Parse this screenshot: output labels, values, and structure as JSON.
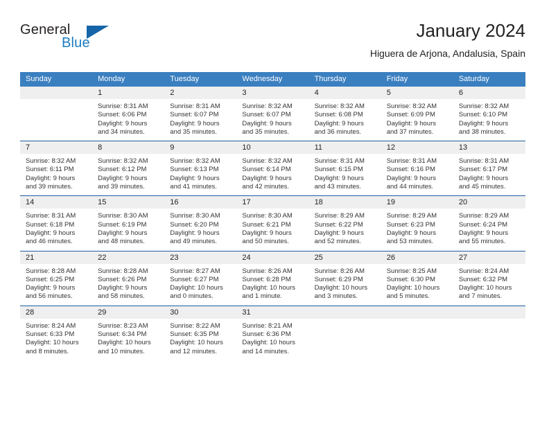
{
  "brand": {
    "name_part1": "General",
    "name_part2": "Blue",
    "triangle_color": "#1565a8",
    "blue_color": "#1a7cc2"
  },
  "header": {
    "title": "January 2024",
    "subtitle": "Higuera de Arjona, Andalusia, Spain",
    "header_bg": "#3a7fc0",
    "week_separator_color": "#1f5fa0",
    "daynum_band_color": "#efefef"
  },
  "calendar": {
    "day_names": [
      "Sunday",
      "Monday",
      "Tuesday",
      "Wednesday",
      "Thursday",
      "Friday",
      "Saturday"
    ],
    "weeks": [
      [
        {
          "day": "",
          "empty": true,
          "sunrise": "",
          "sunset": "",
          "daylight_line1": "",
          "daylight_line2": ""
        },
        {
          "day": "1",
          "empty": false,
          "sunrise": "Sunrise: 8:31 AM",
          "sunset": "Sunset: 6:06 PM",
          "daylight_line1": "Daylight: 9 hours",
          "daylight_line2": "and 34 minutes."
        },
        {
          "day": "2",
          "empty": false,
          "sunrise": "Sunrise: 8:31 AM",
          "sunset": "Sunset: 6:07 PM",
          "daylight_line1": "Daylight: 9 hours",
          "daylight_line2": "and 35 minutes."
        },
        {
          "day": "3",
          "empty": false,
          "sunrise": "Sunrise: 8:32 AM",
          "sunset": "Sunset: 6:07 PM",
          "daylight_line1": "Daylight: 9 hours",
          "daylight_line2": "and 35 minutes."
        },
        {
          "day": "4",
          "empty": false,
          "sunrise": "Sunrise: 8:32 AM",
          "sunset": "Sunset: 6:08 PM",
          "daylight_line1": "Daylight: 9 hours",
          "daylight_line2": "and 36 minutes."
        },
        {
          "day": "5",
          "empty": false,
          "sunrise": "Sunrise: 8:32 AM",
          "sunset": "Sunset: 6:09 PM",
          "daylight_line1": "Daylight: 9 hours",
          "daylight_line2": "and 37 minutes."
        },
        {
          "day": "6",
          "empty": false,
          "sunrise": "Sunrise: 8:32 AM",
          "sunset": "Sunset: 6:10 PM",
          "daylight_line1": "Daylight: 9 hours",
          "daylight_line2": "and 38 minutes."
        }
      ],
      [
        {
          "day": "7",
          "empty": false,
          "sunrise": "Sunrise: 8:32 AM",
          "sunset": "Sunset: 6:11 PM",
          "daylight_line1": "Daylight: 9 hours",
          "daylight_line2": "and 39 minutes."
        },
        {
          "day": "8",
          "empty": false,
          "sunrise": "Sunrise: 8:32 AM",
          "sunset": "Sunset: 6:12 PM",
          "daylight_line1": "Daylight: 9 hours",
          "daylight_line2": "and 39 minutes."
        },
        {
          "day": "9",
          "empty": false,
          "sunrise": "Sunrise: 8:32 AM",
          "sunset": "Sunset: 6:13 PM",
          "daylight_line1": "Daylight: 9 hours",
          "daylight_line2": "and 41 minutes."
        },
        {
          "day": "10",
          "empty": false,
          "sunrise": "Sunrise: 8:32 AM",
          "sunset": "Sunset: 6:14 PM",
          "daylight_line1": "Daylight: 9 hours",
          "daylight_line2": "and 42 minutes."
        },
        {
          "day": "11",
          "empty": false,
          "sunrise": "Sunrise: 8:31 AM",
          "sunset": "Sunset: 6:15 PM",
          "daylight_line1": "Daylight: 9 hours",
          "daylight_line2": "and 43 minutes."
        },
        {
          "day": "12",
          "empty": false,
          "sunrise": "Sunrise: 8:31 AM",
          "sunset": "Sunset: 6:16 PM",
          "daylight_line1": "Daylight: 9 hours",
          "daylight_line2": "and 44 minutes."
        },
        {
          "day": "13",
          "empty": false,
          "sunrise": "Sunrise: 8:31 AM",
          "sunset": "Sunset: 6:17 PM",
          "daylight_line1": "Daylight: 9 hours",
          "daylight_line2": "and 45 minutes."
        }
      ],
      [
        {
          "day": "14",
          "empty": false,
          "sunrise": "Sunrise: 8:31 AM",
          "sunset": "Sunset: 6:18 PM",
          "daylight_line1": "Daylight: 9 hours",
          "daylight_line2": "and 46 minutes."
        },
        {
          "day": "15",
          "empty": false,
          "sunrise": "Sunrise: 8:30 AM",
          "sunset": "Sunset: 6:19 PM",
          "daylight_line1": "Daylight: 9 hours",
          "daylight_line2": "and 48 minutes."
        },
        {
          "day": "16",
          "empty": false,
          "sunrise": "Sunrise: 8:30 AM",
          "sunset": "Sunset: 6:20 PM",
          "daylight_line1": "Daylight: 9 hours",
          "daylight_line2": "and 49 minutes."
        },
        {
          "day": "17",
          "empty": false,
          "sunrise": "Sunrise: 8:30 AM",
          "sunset": "Sunset: 6:21 PM",
          "daylight_line1": "Daylight: 9 hours",
          "daylight_line2": "and 50 minutes."
        },
        {
          "day": "18",
          "empty": false,
          "sunrise": "Sunrise: 8:29 AM",
          "sunset": "Sunset: 6:22 PM",
          "daylight_line1": "Daylight: 9 hours",
          "daylight_line2": "and 52 minutes."
        },
        {
          "day": "19",
          "empty": false,
          "sunrise": "Sunrise: 8:29 AM",
          "sunset": "Sunset: 6:23 PM",
          "daylight_line1": "Daylight: 9 hours",
          "daylight_line2": "and 53 minutes."
        },
        {
          "day": "20",
          "empty": false,
          "sunrise": "Sunrise: 8:29 AM",
          "sunset": "Sunset: 6:24 PM",
          "daylight_line1": "Daylight: 9 hours",
          "daylight_line2": "and 55 minutes."
        }
      ],
      [
        {
          "day": "21",
          "empty": false,
          "sunrise": "Sunrise: 8:28 AM",
          "sunset": "Sunset: 6:25 PM",
          "daylight_line1": "Daylight: 9 hours",
          "daylight_line2": "and 56 minutes."
        },
        {
          "day": "22",
          "empty": false,
          "sunrise": "Sunrise: 8:28 AM",
          "sunset": "Sunset: 6:26 PM",
          "daylight_line1": "Daylight: 9 hours",
          "daylight_line2": "and 58 minutes."
        },
        {
          "day": "23",
          "empty": false,
          "sunrise": "Sunrise: 8:27 AM",
          "sunset": "Sunset: 6:27 PM",
          "daylight_line1": "Daylight: 10 hours",
          "daylight_line2": "and 0 minutes."
        },
        {
          "day": "24",
          "empty": false,
          "sunrise": "Sunrise: 8:26 AM",
          "sunset": "Sunset: 6:28 PM",
          "daylight_line1": "Daylight: 10 hours",
          "daylight_line2": "and 1 minute."
        },
        {
          "day": "25",
          "empty": false,
          "sunrise": "Sunrise: 8:26 AM",
          "sunset": "Sunset: 6:29 PM",
          "daylight_line1": "Daylight: 10 hours",
          "daylight_line2": "and 3 minutes."
        },
        {
          "day": "26",
          "empty": false,
          "sunrise": "Sunrise: 8:25 AM",
          "sunset": "Sunset: 6:30 PM",
          "daylight_line1": "Daylight: 10 hours",
          "daylight_line2": "and 5 minutes."
        },
        {
          "day": "27",
          "empty": false,
          "sunrise": "Sunrise: 8:24 AM",
          "sunset": "Sunset: 6:32 PM",
          "daylight_line1": "Daylight: 10 hours",
          "daylight_line2": "and 7 minutes."
        }
      ],
      [
        {
          "day": "28",
          "empty": false,
          "sunrise": "Sunrise: 8:24 AM",
          "sunset": "Sunset: 6:33 PM",
          "daylight_line1": "Daylight: 10 hours",
          "daylight_line2": "and 8 minutes."
        },
        {
          "day": "29",
          "empty": false,
          "sunrise": "Sunrise: 8:23 AM",
          "sunset": "Sunset: 6:34 PM",
          "daylight_line1": "Daylight: 10 hours",
          "daylight_line2": "and 10 minutes."
        },
        {
          "day": "30",
          "empty": false,
          "sunrise": "Sunrise: 8:22 AM",
          "sunset": "Sunset: 6:35 PM",
          "daylight_line1": "Daylight: 10 hours",
          "daylight_line2": "and 12 minutes."
        },
        {
          "day": "31",
          "empty": false,
          "sunrise": "Sunrise: 8:21 AM",
          "sunset": "Sunset: 6:36 PM",
          "daylight_line1": "Daylight: 10 hours",
          "daylight_line2": "and 14 minutes."
        },
        {
          "day": "",
          "empty": true,
          "sunrise": "",
          "sunset": "",
          "daylight_line1": "",
          "daylight_line2": ""
        },
        {
          "day": "",
          "empty": true,
          "sunrise": "",
          "sunset": "",
          "daylight_line1": "",
          "daylight_line2": ""
        },
        {
          "day": "",
          "empty": true,
          "sunrise": "",
          "sunset": "",
          "daylight_line1": "",
          "daylight_line2": ""
        }
      ]
    ]
  }
}
